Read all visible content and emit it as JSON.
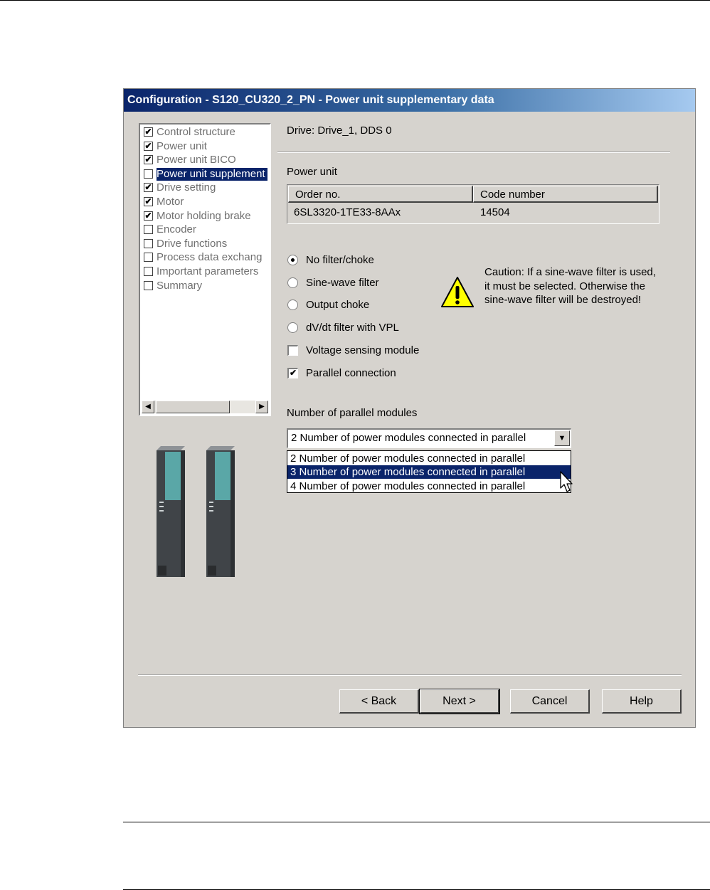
{
  "window": {
    "title": "Configuration - S120_CU320_2_PN - Power unit supplementary data"
  },
  "tree": {
    "items": [
      {
        "label": "Control structure",
        "checked": true
      },
      {
        "label": "Power unit",
        "checked": true
      },
      {
        "label": "Power unit BICO",
        "checked": true
      },
      {
        "label": "Power unit supplement",
        "checked": false,
        "selected": true
      },
      {
        "label": "Drive setting",
        "checked": true
      },
      {
        "label": "Motor",
        "checked": true
      },
      {
        "label": "Motor holding brake",
        "checked": true
      },
      {
        "label": "Encoder",
        "checked": false
      },
      {
        "label": "Drive functions",
        "checked": false
      },
      {
        "label": "Process data exchang",
        "checked": false
      },
      {
        "label": "Important parameters",
        "checked": false
      },
      {
        "label": "Summary",
        "checked": false
      }
    ],
    "scroll_left_icon": "arrow-left-icon",
    "scroll_right_icon": "arrow-right-icon"
  },
  "drive_label": "Drive: Drive_1, DDS 0",
  "power_unit": {
    "section_label": "Power unit",
    "columns": [
      "Order no.",
      "Code number"
    ],
    "rows": [
      [
        "6SL3320-1TE33-8AAx",
        "14504"
      ]
    ]
  },
  "filter_options": [
    {
      "label": "No filter/choke",
      "selected": true
    },
    {
      "label": "Sine-wave filter",
      "selected": false
    },
    {
      "label": "Output choke",
      "selected": false
    },
    {
      "label": "dV/dt filter with VPL",
      "selected": false
    }
  ],
  "checkboxes": [
    {
      "label": "Voltage sensing module",
      "checked": false
    },
    {
      "label": "Parallel connection",
      "checked": true
    }
  ],
  "caution": {
    "icon": "warning-icon",
    "text": "Caution: If a sine-wave filter is used, it must be selected. Otherwise the sine-wave filter will be destroyed!"
  },
  "parallel": {
    "label": "Number of parallel modules",
    "selected_value": "2 Number of power modules connected in parallel",
    "options": [
      "2 Number of power modules connected in parallel",
      "3 Number of power modules connected in parallel",
      "4 Number of power modules connected in parallel"
    ],
    "highlighted_index": 1
  },
  "buttons": {
    "back": "< Back",
    "next": "Next >",
    "cancel": "Cancel",
    "help": "Help"
  },
  "colors": {
    "dialog_bg": "#d6d3ce",
    "title_start": "#0a246a",
    "title_end": "#a6caf0",
    "selection": "#0a246a",
    "module_teal": "#5aa7a7",
    "module_body": "#404448"
  }
}
